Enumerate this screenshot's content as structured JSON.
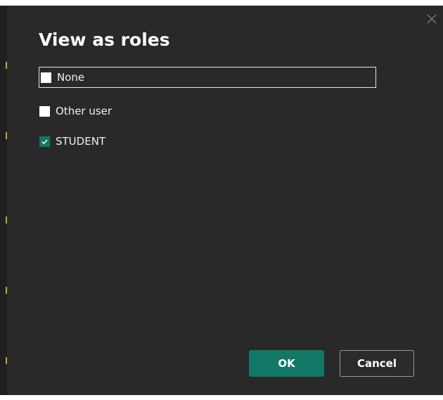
{
  "dialog": {
    "title": "View as roles",
    "close_icon": "close-icon"
  },
  "roles": [
    {
      "label": "None",
      "checked": false
    },
    {
      "label": "Other user",
      "checked": false
    },
    {
      "label": "STUDENT",
      "checked": true
    }
  ],
  "buttons": {
    "ok_label": "OK",
    "cancel_label": "Cancel"
  },
  "colors": {
    "dialog_bg": "#292929",
    "accent": "#117865",
    "text": "#ffffff"
  }
}
